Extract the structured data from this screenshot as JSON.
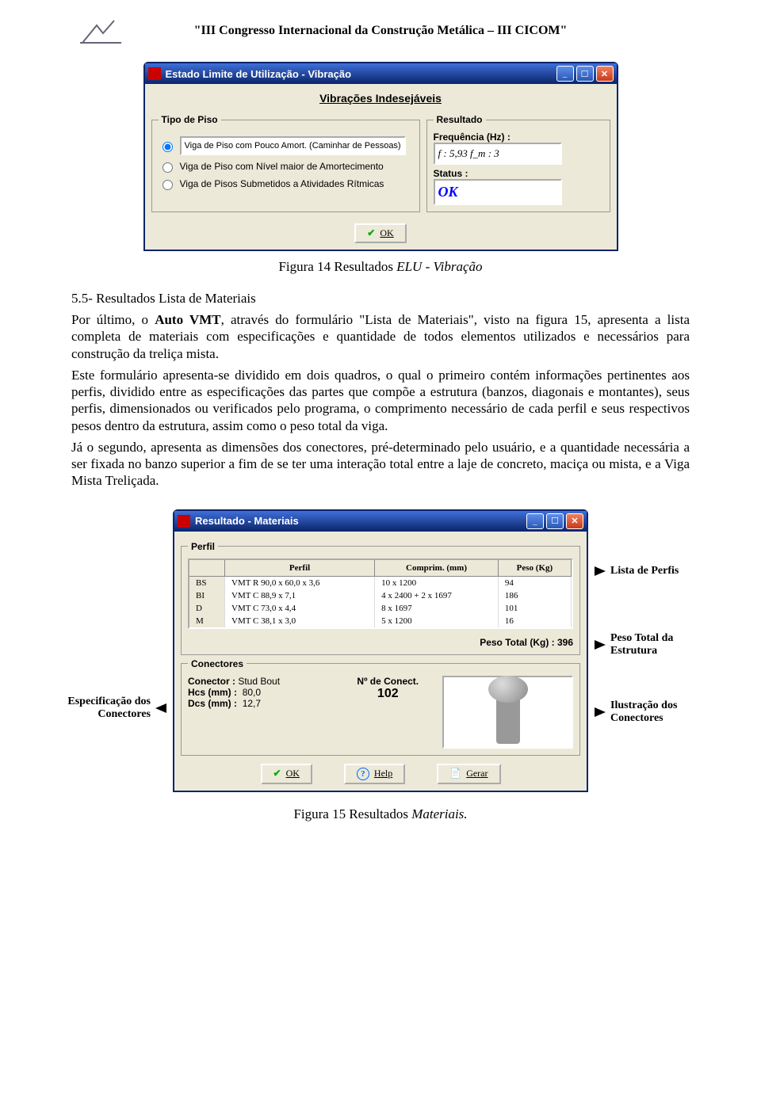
{
  "header": "\"III Congresso Internacional da Construção Metálica – III CICOM\"",
  "win1": {
    "title": "Estado Limite de Utilização - Vibração",
    "subtitle": "Vibrações Indesejáveis",
    "grp_tipo": "Tipo de Piso",
    "opt1": "Viga de Piso com Pouco Amort. (Caminhar de Pessoas)",
    "opt2": "Viga de Piso com Nível maior de Amortecimento",
    "opt3": "Viga de Pisos Submetidos a Atividades Rítmicas",
    "grp_res": "Resultado",
    "freq_lbl": "Frequência (Hz) :",
    "freq_val": "f : 5,93    f_m :  3",
    "status_lbl": "Status :",
    "status_val": "OK",
    "ok": "OK"
  },
  "caption1": "Figura 14 Resultados ELU - Vibração",
  "sec_h": "5.5- Resultados Lista de Materiais",
  "p1a": "Por último, o ",
  "p1b": "Auto VMT",
  "p1c": ", através do formulário \"Lista de Materiais\", visto na figura 15, apresenta a lista completa de materiais com especificações e quantidade de todos elementos utilizados e necessários para construção da treliça mista.",
  "p2": "Este formulário apresenta-se dividido em dois quadros, o qual o primeiro contém informações pertinentes aos perfis, dividido entre as especificações das partes que compõe a estrutura (banzos, diagonais e montantes), seus perfis, dimensionados ou verificados pelo programa, o comprimento necessário de cada perfil e seus respectivos pesos dentro da estrutura, assim como o peso total da viga.",
  "p3": "Já o segundo, apresenta as dimensões dos conectores, pré-determinado pelo usuário, e a quantidade necessária a ser fixada no banzo superior a fim de se ter uma interação total entre a laje de concreto, maciça ou mista, e a Viga Mista Treliçada.",
  "win2": {
    "title": "Resultado - Materiais",
    "grp_perfil": "Perfil",
    "th1": "Perfil",
    "th2": "Comprim. (mm)",
    "th3": "Peso (Kg)",
    "rows": [
      {
        "k": "BS",
        "p": "VMT  R  90,0 x 60,0 x 3,6",
        "c": "10 x 1200",
        "w": "94"
      },
      {
        "k": "BI",
        "p": "VMT  C  88,9 x 7,1",
        "c": "4 x 2400 + 2 x 1697",
        "w": "186"
      },
      {
        "k": "D",
        "p": "VMT  C  73,0 x 4,4",
        "c": "8 x 1697",
        "w": "101"
      },
      {
        "k": "M",
        "p": "VMT  C  38,1 x 3,0",
        "c": "5 x 1200",
        "w": "16"
      }
    ],
    "total": "Peso Total (Kg) :  396",
    "grp_con": "Conectores",
    "con_lbl": "Conector :",
    "con_val": "Stud Bout",
    "hcs_lbl": "Hcs (mm) :",
    "hcs_val": "80,0",
    "dcs_lbl": "Dcs (mm) :",
    "dcs_val": "12,7",
    "ncon_lbl": "Nº de Conect.",
    "ncon_val": "102",
    "ok": "OK",
    "help": "Help",
    "gerar": "Gerar"
  },
  "ann": {
    "lista": "Lista de Perfis",
    "peso": "Peso Total da Estrutura",
    "espec": "Especificação dos Conectores",
    "ilust": "Ilustração dos Conectores"
  },
  "caption2": "Figura 15 Resultados Materiais."
}
